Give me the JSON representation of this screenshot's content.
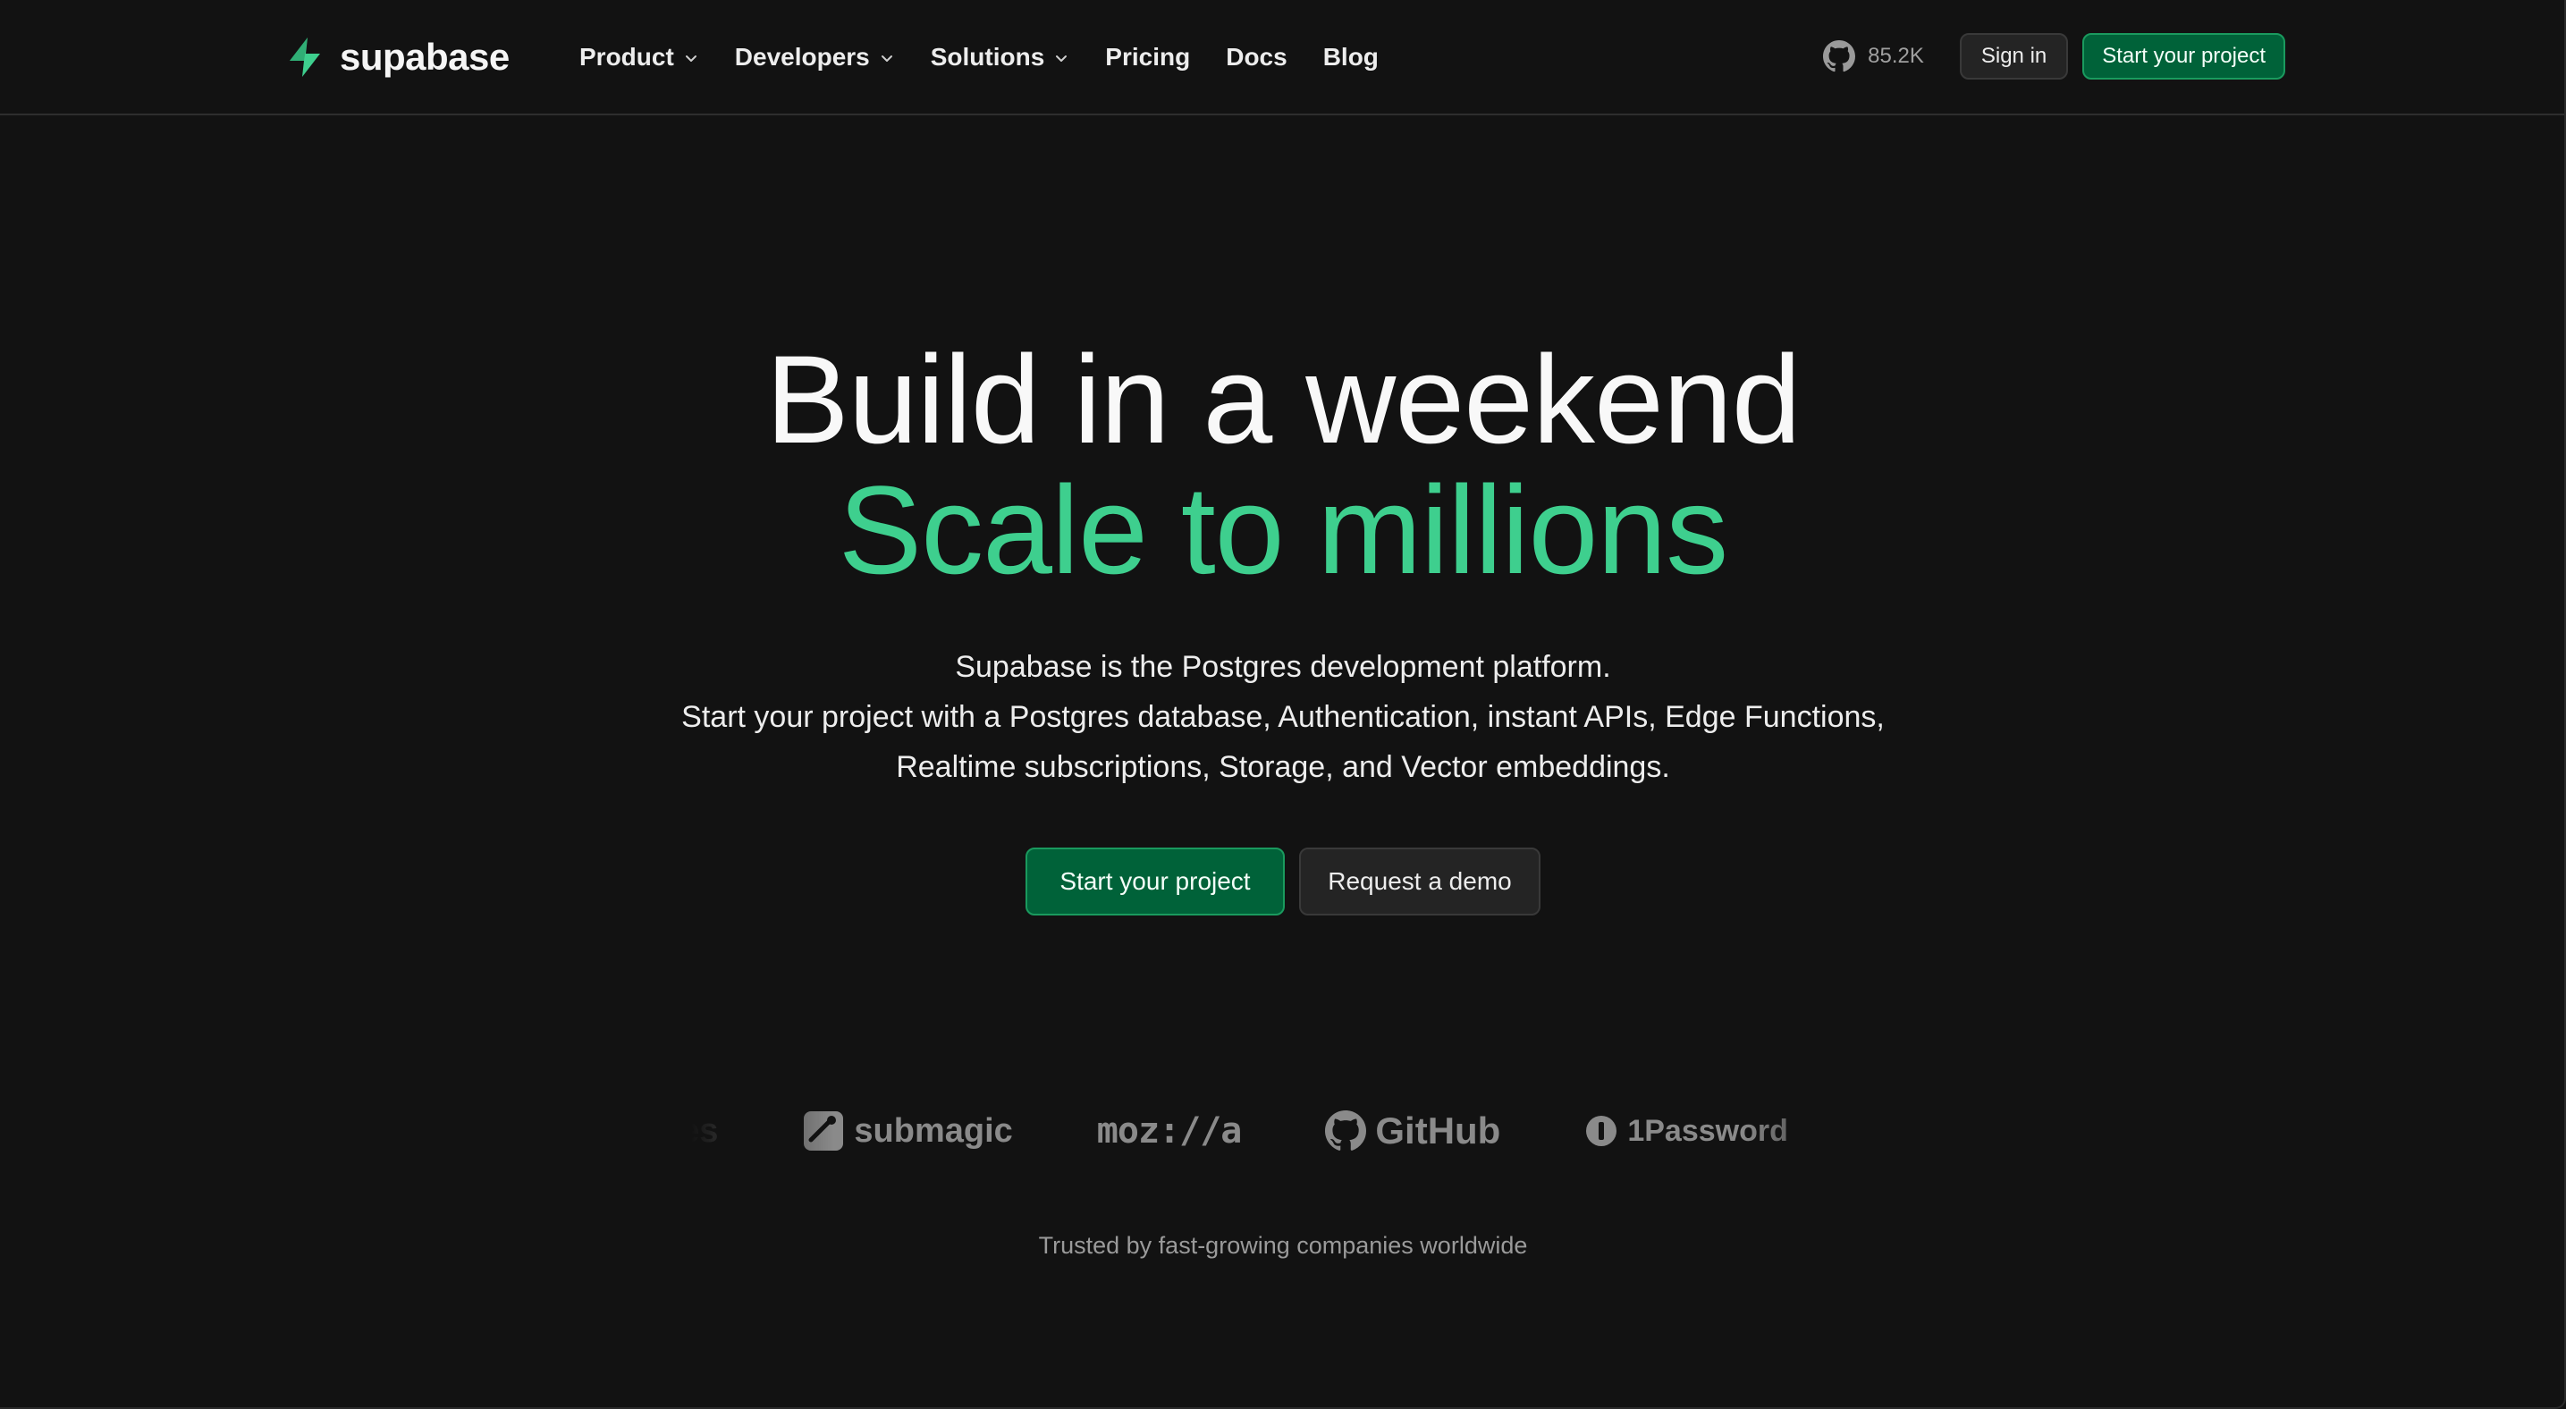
{
  "nav": {
    "logo_text": "supabase",
    "menu": [
      {
        "label": "Product",
        "has_dropdown": true
      },
      {
        "label": "Developers",
        "has_dropdown": true
      },
      {
        "label": "Solutions",
        "has_dropdown": true
      },
      {
        "label": "Pricing",
        "has_dropdown": false
      },
      {
        "label": "Docs",
        "has_dropdown": false
      },
      {
        "label": "Blog",
        "has_dropdown": false
      }
    ],
    "github_stars": "85.2K",
    "sign_in": "Sign in",
    "start_project": "Start your project"
  },
  "hero": {
    "title_line1": "Build in a weekend",
    "title_line2": "Scale to millions",
    "subtitle_line1": "Supabase is the Postgres development platform.",
    "subtitle_line2": "Start your project with a Postgres database, Authentication, instant APIs, Edge Functions, Realtime subscriptions, Storage, and Vector embeddings.",
    "cta_primary": "Start your project",
    "cta_secondary": "Request a demo"
  },
  "logos": {
    "items": [
      "hares",
      "submagic",
      "moz://a",
      "GitHub",
      "1Password"
    ],
    "caption": "Trusted by fast-growing companies worldwide"
  },
  "colors": {
    "background": "#121212",
    "brand_green": "#3ecf8e",
    "button_green": "#006239",
    "text": "#ededed",
    "muted": "#9a9a9a"
  },
  "icons": [
    "supabase-logo-icon",
    "chevron-down-icon",
    "github-icon"
  ]
}
